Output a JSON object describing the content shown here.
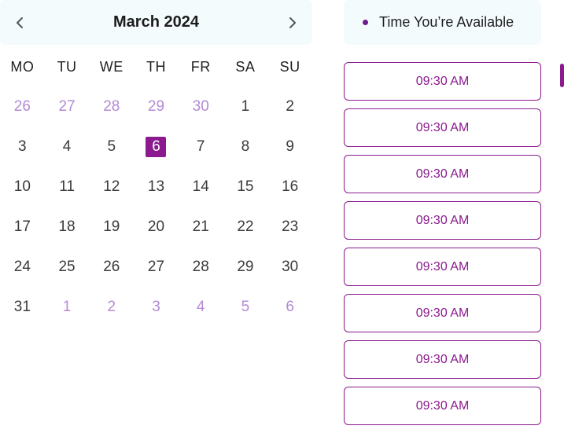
{
  "calendar": {
    "month_title": "March 2024",
    "weekdays": [
      "MO",
      "TU",
      "WE",
      "TH",
      "FR",
      "SA",
      "SU"
    ],
    "days": [
      {
        "label": "26",
        "muted": true
      },
      {
        "label": "27",
        "muted": true
      },
      {
        "label": "28",
        "muted": true
      },
      {
        "label": "29",
        "muted": true
      },
      {
        "label": "30",
        "muted": true
      },
      {
        "label": "1"
      },
      {
        "label": "2"
      },
      {
        "label": "3"
      },
      {
        "label": "4"
      },
      {
        "label": "5"
      },
      {
        "label": "6",
        "selected": true
      },
      {
        "label": "7"
      },
      {
        "label": "8"
      },
      {
        "label": "9"
      },
      {
        "label": "10"
      },
      {
        "label": "11"
      },
      {
        "label": "12"
      },
      {
        "label": "13"
      },
      {
        "label": "14"
      },
      {
        "label": "15"
      },
      {
        "label": "16"
      },
      {
        "label": "17"
      },
      {
        "label": "18"
      },
      {
        "label": "19"
      },
      {
        "label": "20"
      },
      {
        "label": "21"
      },
      {
        "label": "22"
      },
      {
        "label": "23"
      },
      {
        "label": "24"
      },
      {
        "label": "25"
      },
      {
        "label": "26"
      },
      {
        "label": "27"
      },
      {
        "label": "28"
      },
      {
        "label": "29"
      },
      {
        "label": "30"
      },
      {
        "label": "31"
      },
      {
        "label": "1",
        "muted": true
      },
      {
        "label": "2",
        "muted": true
      },
      {
        "label": "3",
        "muted": true
      },
      {
        "label": "4",
        "muted": true
      },
      {
        "label": "5",
        "muted": true
      },
      {
        "label": "6",
        "muted": true
      }
    ],
    "prev_icon": "chevron-left-icon",
    "next_icon": "chevron-right-icon"
  },
  "availability": {
    "legend_label": "Time You’re Available",
    "slots": [
      "09:30 AM",
      "09:30 AM",
      "09:30 AM",
      "09:30 AM",
      "09:30 AM",
      "09:30 AM",
      "09:30 AM",
      "09:30 AM"
    ]
  },
  "colors": {
    "accent": "#8b1a8e",
    "muted_day": "#b48ad6",
    "header_bg": "#f3fbfd"
  }
}
